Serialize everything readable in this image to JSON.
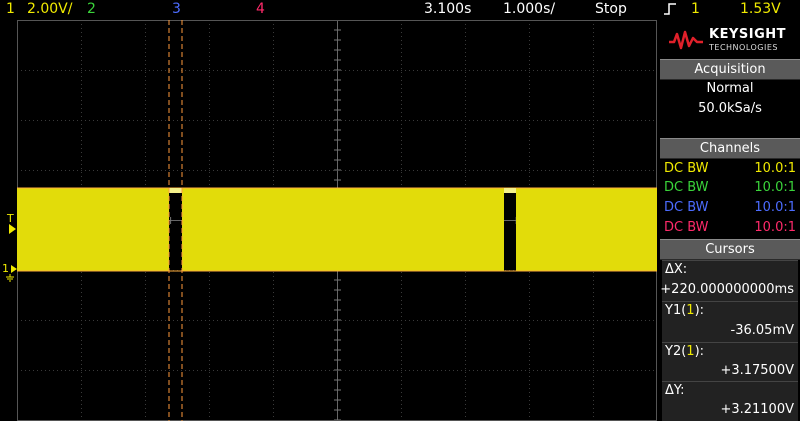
{
  "top_bar": {
    "ch1_num": "1",
    "ch1_scale": "2.00V/",
    "ch2_num": "2",
    "ch3_num": "3",
    "ch4_num": "4",
    "time_delay": "3.100s",
    "time_scale": "1.000s/",
    "run_state": "Stop",
    "trigger_icon": "rising-edge-trigger-icon",
    "trigger_source": "1",
    "trigger_level": "1.53V"
  },
  "markers": {
    "trigger_level_marker": "T",
    "ch1_ground_marker": "1"
  },
  "brand": {
    "name": "KEYSIGHT",
    "sub": "TECHNOLOGIES"
  },
  "acquisition": {
    "header": "Acquisition",
    "mode": "Normal",
    "rate": "50.0kSa/s"
  },
  "channels": {
    "header": "Channels",
    "rows": [
      {
        "coupling": "DC BW",
        "probe": "10.0:1",
        "color": "#f0ea00"
      },
      {
        "coupling": "DC BW",
        "probe": "10.0:1",
        "color": "#3ad43a"
      },
      {
        "coupling": "DC BW",
        "probe": "10.0:1",
        "color": "#4c6cff"
      },
      {
        "coupling": "DC BW",
        "probe": "10.0:1",
        "color": "#ff2a6a"
      }
    ]
  },
  "cursors": {
    "header": "Cursors",
    "dx_label": "ΔX:",
    "dx_value": "+220.000000000ms",
    "y1_label": "Y1(1):",
    "y1_value": "-36.05mV",
    "y2_label": "Y2(1):",
    "y2_value": "+3.17500V",
    "dy_label": "ΔY:",
    "dy_value": "+3.21100V"
  },
  "colors": {
    "ch1": "#f0ea00",
    "ch2": "#3ad43a",
    "ch3": "#4c6cff",
    "ch4": "#ff2a6a",
    "cursor": "#ff9a3c",
    "header_bg": "#5a5a5a",
    "brand_red": "#e0202a"
  },
  "trace": {
    "channel": "1",
    "high_level_v": 3.175,
    "low_level_v": -0.036,
    "gap_count": 2
  }
}
